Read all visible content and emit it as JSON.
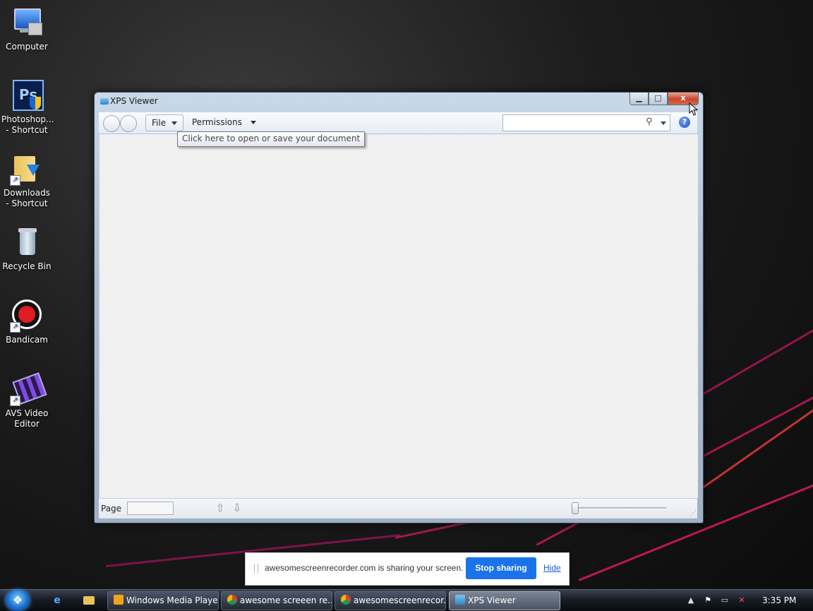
{
  "desktop": {
    "icons": [
      {
        "label": "Computer"
      },
      {
        "label": "Photoshop... - Shortcut"
      },
      {
        "label": "Downloads - Shortcut"
      },
      {
        "label": "Recycle Bin"
      },
      {
        "label": "Bandicam"
      },
      {
        "label": "AVS Video Editor"
      }
    ]
  },
  "window": {
    "title": "XPS Viewer",
    "close_label": "x",
    "toolbar": {
      "file_label": "File",
      "permissions_label": "Permissions",
      "search_placeholder": "",
      "help_label": "?"
    },
    "tooltip": "Click here to open or save your document",
    "status": {
      "page_label": "Page",
      "page_value": ""
    }
  },
  "sharing_bar": {
    "message": "awesomescreenrecorder.com is sharing your screen.",
    "stop_label": "Stop sharing",
    "hide_label": "Hide"
  },
  "taskbar": {
    "buttons": [
      {
        "label": "Windows Media Player",
        "active": false
      },
      {
        "label": "awesome screeen re...",
        "active": false
      },
      {
        "label": "awesomescreenrecor...",
        "active": false
      },
      {
        "label": "XPS Viewer",
        "active": true
      }
    ],
    "clock": "3:35 PM"
  },
  "colors": {
    "accent_blue": "#1a73e8",
    "close_red": "#c9452b"
  }
}
